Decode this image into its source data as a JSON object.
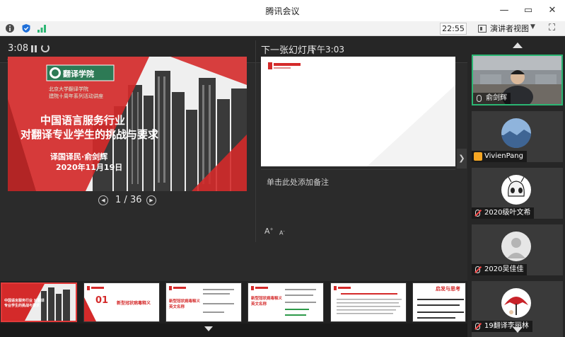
{
  "app": {
    "title": "腾讯会议"
  },
  "toolbar": {
    "time": "22:55",
    "presenter_view_label": "演讲者视图"
  },
  "presenter": {
    "elapsed": "3:08",
    "clock": "下午3:03",
    "next_slide_label": "下一张幻灯片",
    "notes_placeholder": "单击此处添加备注",
    "font_up": "A",
    "font_down": "A",
    "slide_current": "1",
    "slide_total": "36",
    "slide_count_sep": "/"
  },
  "current_slide": {
    "logo_text": "翻译学院",
    "subtitle_line1": "北京大学翻译学院",
    "subtitle_line2": "建院十周年系列活动讲座",
    "title_line1": "中国语言服务行业",
    "title_line2": "对翻译专业学生的挑战与要求",
    "speaker": "译国译民·俞剑辉",
    "date": "2020年11月19日"
  },
  "thumbnails": [
    {
      "title": "中国语言服务行业 对翻译专业学生的挑战与要求",
      "active": true
    },
    {
      "number": "01",
      "title": "新型冠状病毒释义",
      "active": false
    },
    {
      "title": "新型冠状病毒释义 英文名称",
      "active": false
    },
    {
      "title": "新型冠状病毒释义 英文名称",
      "active": false
    },
    {
      "title": "",
      "active": false
    },
    {
      "title": "启发与思考",
      "active": false
    }
  ],
  "participants": [
    {
      "name": "俞剑辉",
      "active": true,
      "muted": false,
      "badge": false
    },
    {
      "name": "VivienPang",
      "active": false,
      "muted": false,
      "badge": true
    },
    {
      "name": "2020级叶文希",
      "active": false,
      "muted": true,
      "badge": false
    },
    {
      "name": "2020吴佳佳",
      "active": false,
      "muted": true,
      "badge": false
    },
    {
      "name": "19翻译李丽林",
      "active": false,
      "muted": true,
      "badge": false
    }
  ],
  "colors": {
    "accent_red": "#d42a2a",
    "active_border": "#2bb673",
    "panel_bg": "#2b2b2b"
  }
}
